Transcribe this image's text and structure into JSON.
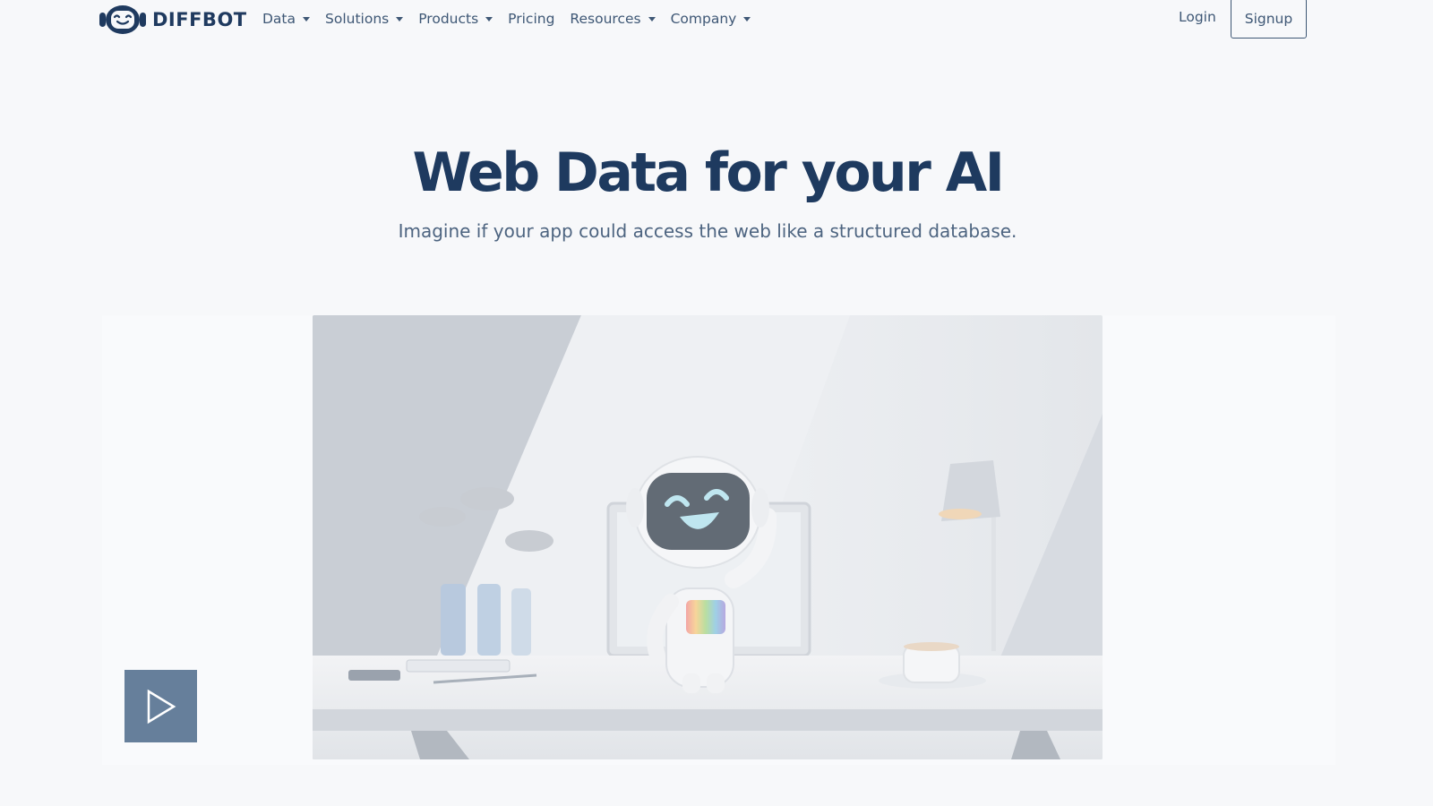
{
  "brand": {
    "name": "DIFFBOT",
    "logo_icon": "robot-head-icon"
  },
  "nav": {
    "items": [
      {
        "label": "Data",
        "dropdown": true
      },
      {
        "label": "Solutions",
        "dropdown": true
      },
      {
        "label": "Products",
        "dropdown": true
      },
      {
        "label": "Pricing",
        "dropdown": false
      },
      {
        "label": "Resources",
        "dropdown": true
      },
      {
        "label": "Company",
        "dropdown": true
      }
    ],
    "login_label": "Login",
    "signup_label": "Signup"
  },
  "hero": {
    "title": "Web Data for your AI",
    "subtitle": "Imagine if your app could access the web like a structured database."
  },
  "video": {
    "play_icon": "play-icon",
    "scene_icon": "robot-at-desk-illustration"
  },
  "colors": {
    "brand_navy": "#1e3a5f",
    "nav_text": "#3e5775",
    "play_button": "#667f9b",
    "page_background": "#f7f8fa"
  }
}
